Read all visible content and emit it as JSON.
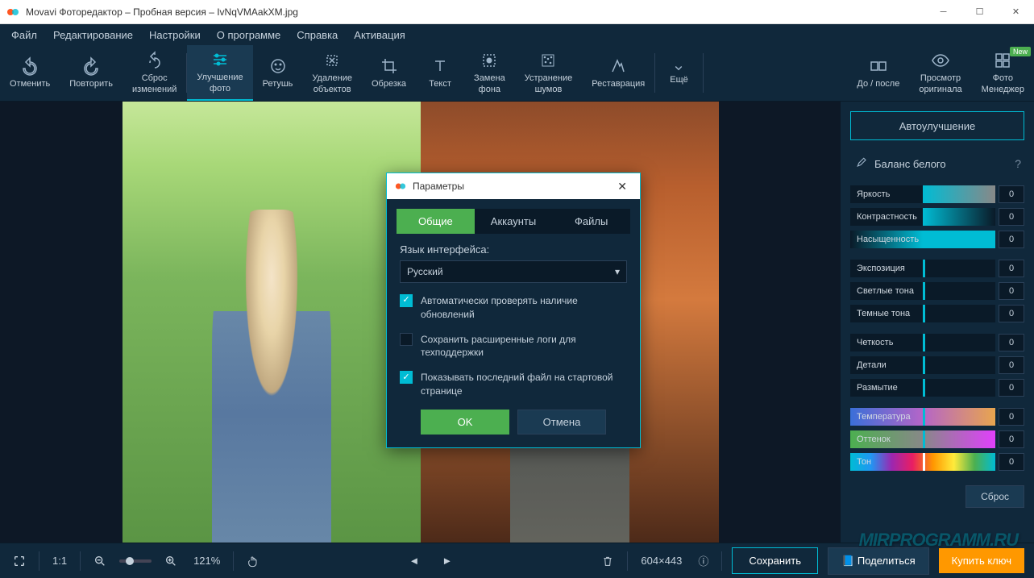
{
  "titlebar": {
    "text": "Movavi Фоторедактор – Пробная версия – IvNqVMAakXM.jpg"
  },
  "menu": {
    "file": "Файл",
    "edit": "Редактирование",
    "settings": "Настройки",
    "about": "О программе",
    "help": "Справка",
    "activation": "Активация"
  },
  "toolbar": {
    "undo": "Отменить",
    "redo": "Повторить",
    "reset": "Сброс\nизменений",
    "enhance": "Улучшение\nфото",
    "retouch": "Ретушь",
    "remove": "Удаление\nобъектов",
    "crop": "Обрезка",
    "text": "Текст",
    "bgswap": "Замена\nфона",
    "denoise": "Устранение\nшумов",
    "restore": "Реставрация",
    "more": "Ещё",
    "before_after": "До / после",
    "view_orig": "Просмотр\nоригинала",
    "photo_mgr": "Фото\nМенеджер",
    "new_badge": "New"
  },
  "panel": {
    "auto": "Автоулучшение",
    "wb": "Баланс белого",
    "sliders": {
      "brightness": {
        "label": "Яркость",
        "val": "0"
      },
      "contrast": {
        "label": "Контрастность",
        "val": "0"
      },
      "saturation": {
        "label": "Насыщенность",
        "val": "0"
      },
      "exposure": {
        "label": "Экспозиция",
        "val": "0"
      },
      "highlights": {
        "label": "Светлые тона",
        "val": "0"
      },
      "shadows": {
        "label": "Темные тона",
        "val": "0"
      },
      "sharpness": {
        "label": "Четкость",
        "val": "0"
      },
      "detail": {
        "label": "Детали",
        "val": "0"
      },
      "blur": {
        "label": "Размытие",
        "val": "0"
      },
      "temp": {
        "label": "Температура",
        "val": "0"
      },
      "tint": {
        "label": "Оттенок",
        "val": "0"
      },
      "hue": {
        "label": "Тон",
        "val": "0"
      }
    },
    "reset": "Сброс"
  },
  "bottom": {
    "ratio": "1:1",
    "zoom": "121%",
    "dims": "604×443",
    "save": "Сохранить",
    "share": "Поделиться",
    "buy": "Купить ключ"
  },
  "dialog": {
    "title": "Параметры",
    "tabs": {
      "general": "Общие",
      "accounts": "Аккаунты",
      "files": "Файлы"
    },
    "lang_label": "Язык интерфейса:",
    "lang_value": "Русский",
    "chk_updates": "Автоматически проверять наличие обновлений",
    "chk_logs": "Сохранить расширенные логи для техподдержки",
    "chk_lastfile": "Показывать последний файл на стартовой странице",
    "ok": "OK",
    "cancel": "Отмена"
  },
  "watermark": "MIRPROGRAMM.RU"
}
